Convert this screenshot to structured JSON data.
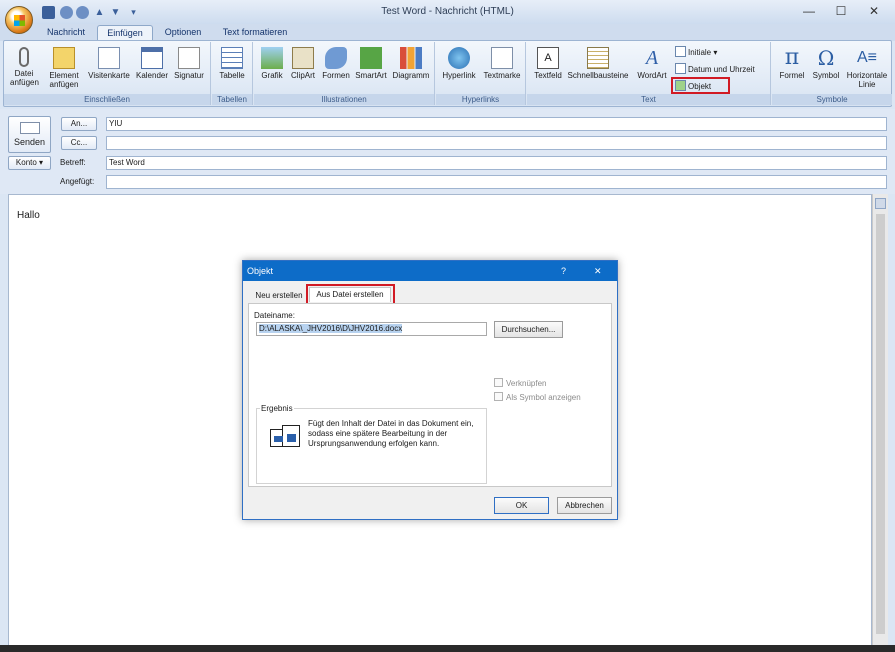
{
  "window": {
    "title": "Test Word - Nachricht (HTML)"
  },
  "ribbon_tabs": [
    "Nachricht",
    "Einfügen",
    "Optionen",
    "Text formatieren"
  ],
  "ribbon": {
    "groups": {
      "einschliessen": "Einschließen",
      "tabellen": "Tabellen",
      "illustrationen": "Illustrationen",
      "hyperlinks": "Hyperlinks",
      "text": "Text",
      "symbole": "Symbole"
    },
    "buttons": {
      "datei": [
        "Datei",
        "anfügen"
      ],
      "element": [
        "Element",
        "anfügen"
      ],
      "visitenkarte": "Visitenkarte",
      "kalender": "Kalender",
      "signatur": "Signatur",
      "tabelle": "Tabelle",
      "grafik": "Grafik",
      "clipart": "ClipArt",
      "formen": "Formen",
      "smartart": "SmartArt",
      "diagramm": "Diagramm",
      "hyperlink": "Hyperlink",
      "textmarke": "Textmarke",
      "textfeld": "Textfeld",
      "schnellbausteine": "Schnellbausteine",
      "wordart": "WordArt",
      "initiale": "Initiale",
      "datum": "Datum und Uhrzeit",
      "objekt": "Objekt",
      "formel": "Formel",
      "symbol": "Symbol",
      "linie": [
        "Horizontale",
        "Linie"
      ]
    }
  },
  "header": {
    "send": "Senden",
    "an": "An...",
    "cc": "Cc...",
    "konto": "Konto",
    "betreff_label": "Betreff:",
    "angefuegt_label": "Angefügt:",
    "to_value": "YIU",
    "cc_value": "",
    "subject_value": "Test Word",
    "attached_value": ""
  },
  "body": {
    "text": "Hallo"
  },
  "dialog": {
    "title": "Objekt",
    "help": "?",
    "close": "✕",
    "tabs": [
      "Neu erstellen",
      "Aus Datei erstellen"
    ],
    "filename_label": "Dateiname:",
    "filename_value": "D:\\ALASKA\\_JHV2016\\D\\JHV2016.docx",
    "browse": "Durchsuchen...",
    "link_label": "Verknüpfen",
    "symbol_label": "Als Symbol anzeigen",
    "result_label": "Ergebnis",
    "result_text": "Fügt den Inhalt der Datei in das Dokument ein, sodass eine spätere Bearbeitung in der Ursprungsanwendung erfolgen kann.",
    "ok": "OK",
    "cancel": "Abbrechen"
  },
  "colors": {
    "highlight": "#d11a24",
    "dialog_title": "#0d6cc8"
  }
}
